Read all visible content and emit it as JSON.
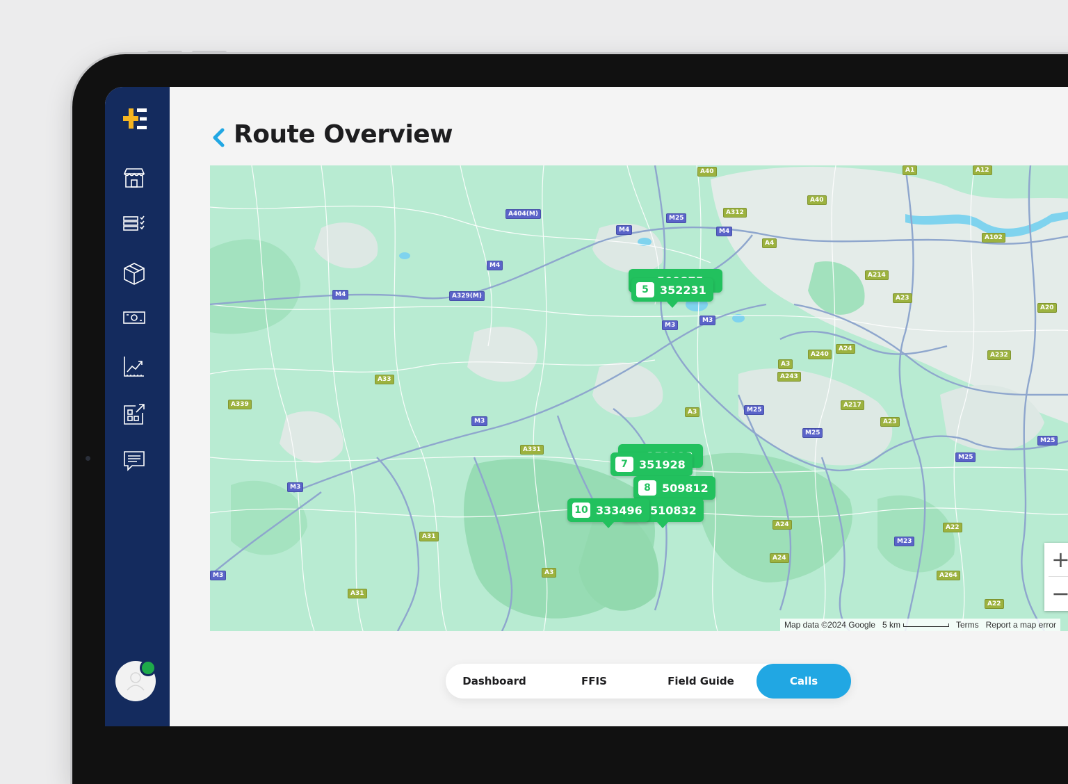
{
  "header": {
    "title": "Route Overview"
  },
  "sidebar": {
    "items": [
      {
        "icon": "store-icon"
      },
      {
        "icon": "checklist-icon"
      },
      {
        "icon": "package-icon"
      },
      {
        "icon": "cash-icon"
      },
      {
        "icon": "chart-icon"
      },
      {
        "icon": "external-widget-icon"
      },
      {
        "icon": "message-icon"
      }
    ]
  },
  "map": {
    "markers": [
      {
        "num": "",
        "code": "509875"
      },
      {
        "num": "5",
        "code": "352231"
      },
      {
        "num": "",
        "code": "351923"
      },
      {
        "num": "7",
        "code": "351928"
      },
      {
        "num": "8",
        "code": "509812"
      },
      {
        "num": "",
        "code": "510832"
      },
      {
        "num": "10",
        "code": "333496"
      }
    ],
    "road_labels": [
      "A40",
      "A1",
      "A12",
      "A404(M)",
      "M25",
      "A312",
      "A40",
      "M4",
      "M4",
      "A4",
      "A102",
      "M4",
      "A214",
      "M4",
      "A329(M)",
      "A23",
      "A20",
      "M3",
      "M3",
      "A240",
      "A24",
      "A3",
      "A243",
      "A232",
      "A33",
      "A339",
      "A3",
      "M25",
      "A217",
      "M3",
      "A23",
      "M25",
      "M25",
      "A331",
      "M25",
      "M3",
      "A24",
      "A22",
      "M23",
      "A31",
      "A24",
      "A264",
      "M3",
      "A3",
      "A31",
      "A22"
    ],
    "attribution": "Map data ©2024 Google",
    "scale": "5 km",
    "terms": "Terms",
    "report": "Report a map error",
    "zoom_in": "+",
    "zoom_out": "−"
  },
  "tabs": [
    {
      "label": "Dashboard"
    },
    {
      "label": "FFIS"
    },
    {
      "label": "Field Guide"
    },
    {
      "label": "Calls"
    }
  ],
  "colors": {
    "sidebar": "#142b5e",
    "accent": "#21a7e3",
    "marker": "#22c15e",
    "logo": "#f5b521"
  }
}
